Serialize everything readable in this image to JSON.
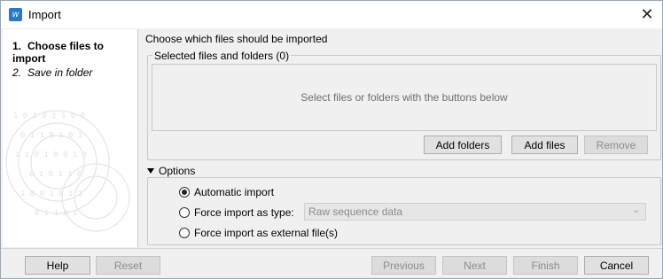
{
  "window": {
    "title": "Import"
  },
  "steps": [
    {
      "num": "1.",
      "label": "Choose files to import"
    },
    {
      "num": "2.",
      "label": "Save in folder"
    }
  ],
  "main": {
    "heading": "Choose which files should be imported",
    "files_group": {
      "legend": "Selected files and folders (0)",
      "placeholder": "Select files or folders with the buttons below",
      "add_folders": "Add folders",
      "add_files": "Add files",
      "remove": "Remove"
    },
    "options": {
      "header": "Options",
      "automatic": "Automatic import",
      "force_type": "Force import as type:",
      "type_value": "Raw sequence data",
      "force_external": "Force import as external file(s)"
    }
  },
  "footer": {
    "help": "Help",
    "reset": "Reset",
    "previous": "Previous",
    "next": "Next",
    "finish": "Finish",
    "cancel": "Cancel"
  }
}
